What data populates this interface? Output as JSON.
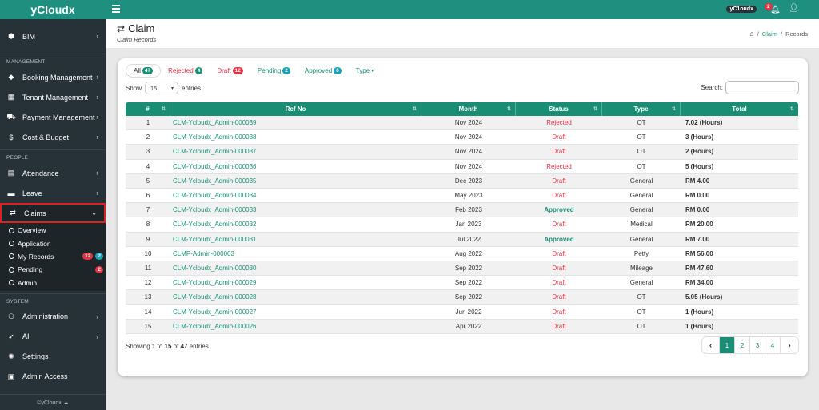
{
  "brand": "yCloudx",
  "colors": {
    "primary": "#1a8e74",
    "sidebar": "#263238",
    "danger": "#e53344",
    "info": "#17a2b8"
  },
  "sidebar": {
    "top_items": [
      {
        "label": "BIM",
        "icon": "cube-icon"
      }
    ],
    "sections": [
      {
        "title": "MANAGEMENT",
        "items": [
          {
            "label": "Booking Management",
            "icon": "tag-icon"
          },
          {
            "label": "Tenant Management",
            "icon": "building-icon"
          },
          {
            "label": "Payment Management",
            "icon": "cart-icon"
          },
          {
            "label": "Cost & Budget",
            "icon": "dollar-icon"
          }
        ]
      },
      {
        "title": "PEOPLE",
        "items": [
          {
            "label": "Attendance",
            "icon": "calendar-icon"
          },
          {
            "label": "Leave",
            "icon": "briefcase-icon"
          },
          {
            "label": "Claims",
            "icon": "exchange-icon"
          }
        ]
      },
      {
        "title": "SYSTEM",
        "items": [
          {
            "label": "Administration",
            "icon": "user-admin-icon"
          },
          {
            "label": "AI",
            "icon": "rocket-icon"
          },
          {
            "label": "Settings",
            "icon": "gear-icon"
          },
          {
            "label": "Admin Access",
            "icon": "lock-icon"
          }
        ]
      }
    ],
    "claims_sub": [
      {
        "label": "Overview"
      },
      {
        "label": "Application"
      },
      {
        "label": "My Records",
        "badge_red": "12",
        "badge_teal": "2"
      },
      {
        "label": "Pending",
        "badge_red": "2"
      },
      {
        "label": "Admin"
      }
    ],
    "footer": "©yCloudx ☁"
  },
  "topbar": {
    "user": "yC1oudx",
    "notifications": "2"
  },
  "header": {
    "title": "Claim",
    "subtitle": "Claim Records",
    "breadcrumb": [
      "Claim",
      "Records"
    ]
  },
  "tabs": [
    {
      "label": "All",
      "count": "47"
    },
    {
      "label": "Rejected",
      "count": "4"
    },
    {
      "label": "Draft",
      "count": "12"
    },
    {
      "label": "Pending",
      "count": "2"
    },
    {
      "label": "Approved",
      "count": "6"
    },
    {
      "label": "Type"
    }
  ],
  "controls": {
    "show": "Show",
    "entries_value": "15",
    "entries": "entries",
    "search": "Search:"
  },
  "table": {
    "columns": [
      "#",
      "Ref No",
      "Month",
      "Status",
      "Type",
      "Total"
    ],
    "rows": [
      [
        "1",
        "CLM-Ycloudx_Admin-000039",
        "Nov 2024",
        "Rejected",
        "OT",
        "7.02 (Hours)"
      ],
      [
        "2",
        "CLM-Ycloudx_Admin-000038",
        "Nov 2024",
        "Draft",
        "OT",
        "3 (Hours)"
      ],
      [
        "3",
        "CLM-Ycloudx_Admin-000037",
        "Nov 2024",
        "Draft",
        "OT",
        "2 (Hours)"
      ],
      [
        "4",
        "CLM-Ycloudx_Admin-000036",
        "Nov 2024",
        "Rejected",
        "OT",
        "5 (Hours)"
      ],
      [
        "5",
        "CLM-Ycloudx_Admin-000035",
        "Dec 2023",
        "Draft",
        "General",
        "RM 4.00"
      ],
      [
        "6",
        "CLM-Ycloudx_Admin-000034",
        "May 2023",
        "Draft",
        "General",
        "RM 0.00"
      ],
      [
        "7",
        "CLM-Ycloudx_Admin-000033",
        "Feb 2023",
        "Approved",
        "General",
        "RM 0.00"
      ],
      [
        "8",
        "CLM-Ycloudx_Admin-000032",
        "Jan 2023",
        "Draft",
        "Medical",
        "RM 20.00"
      ],
      [
        "9",
        "CLM-Ycloudx_Admin-000031",
        "Jul 2022",
        "Approved",
        "General",
        "RM 7.00"
      ],
      [
        "10",
        "CLMP-Admin-000003",
        "Aug 2022",
        "Draft",
        "Petty",
        "RM 56.00"
      ],
      [
        "11",
        "CLM-Ycloudx_Admin-000030",
        "Sep 2022",
        "Draft",
        "Mileage",
        "RM 47.60"
      ],
      [
        "12",
        "CLM-Ycloudx_Admin-000029",
        "Sep 2022",
        "Draft",
        "General",
        "RM 34.00"
      ],
      [
        "13",
        "CLM-Ycloudx_Admin-000028",
        "Sep 2022",
        "Draft",
        "OT",
        "5.05 (Hours)"
      ],
      [
        "14",
        "CLM-Ycloudx_Admin-000027",
        "Jun 2022",
        "Draft",
        "OT",
        "1 (Hours)"
      ],
      [
        "15",
        "CLM-Ycloudx_Admin-000026",
        "Apr 2022",
        "Draft",
        "OT",
        "1 (Hours)"
      ]
    ]
  },
  "footer": {
    "showing_prefix": "Showing",
    "from": "1",
    "to_word": "to",
    "to": "15",
    "of_word": "of",
    "total": "47",
    "suffix": "entries",
    "pages": [
      "1",
      "2",
      "3",
      "4"
    ],
    "current_page": "1"
  }
}
